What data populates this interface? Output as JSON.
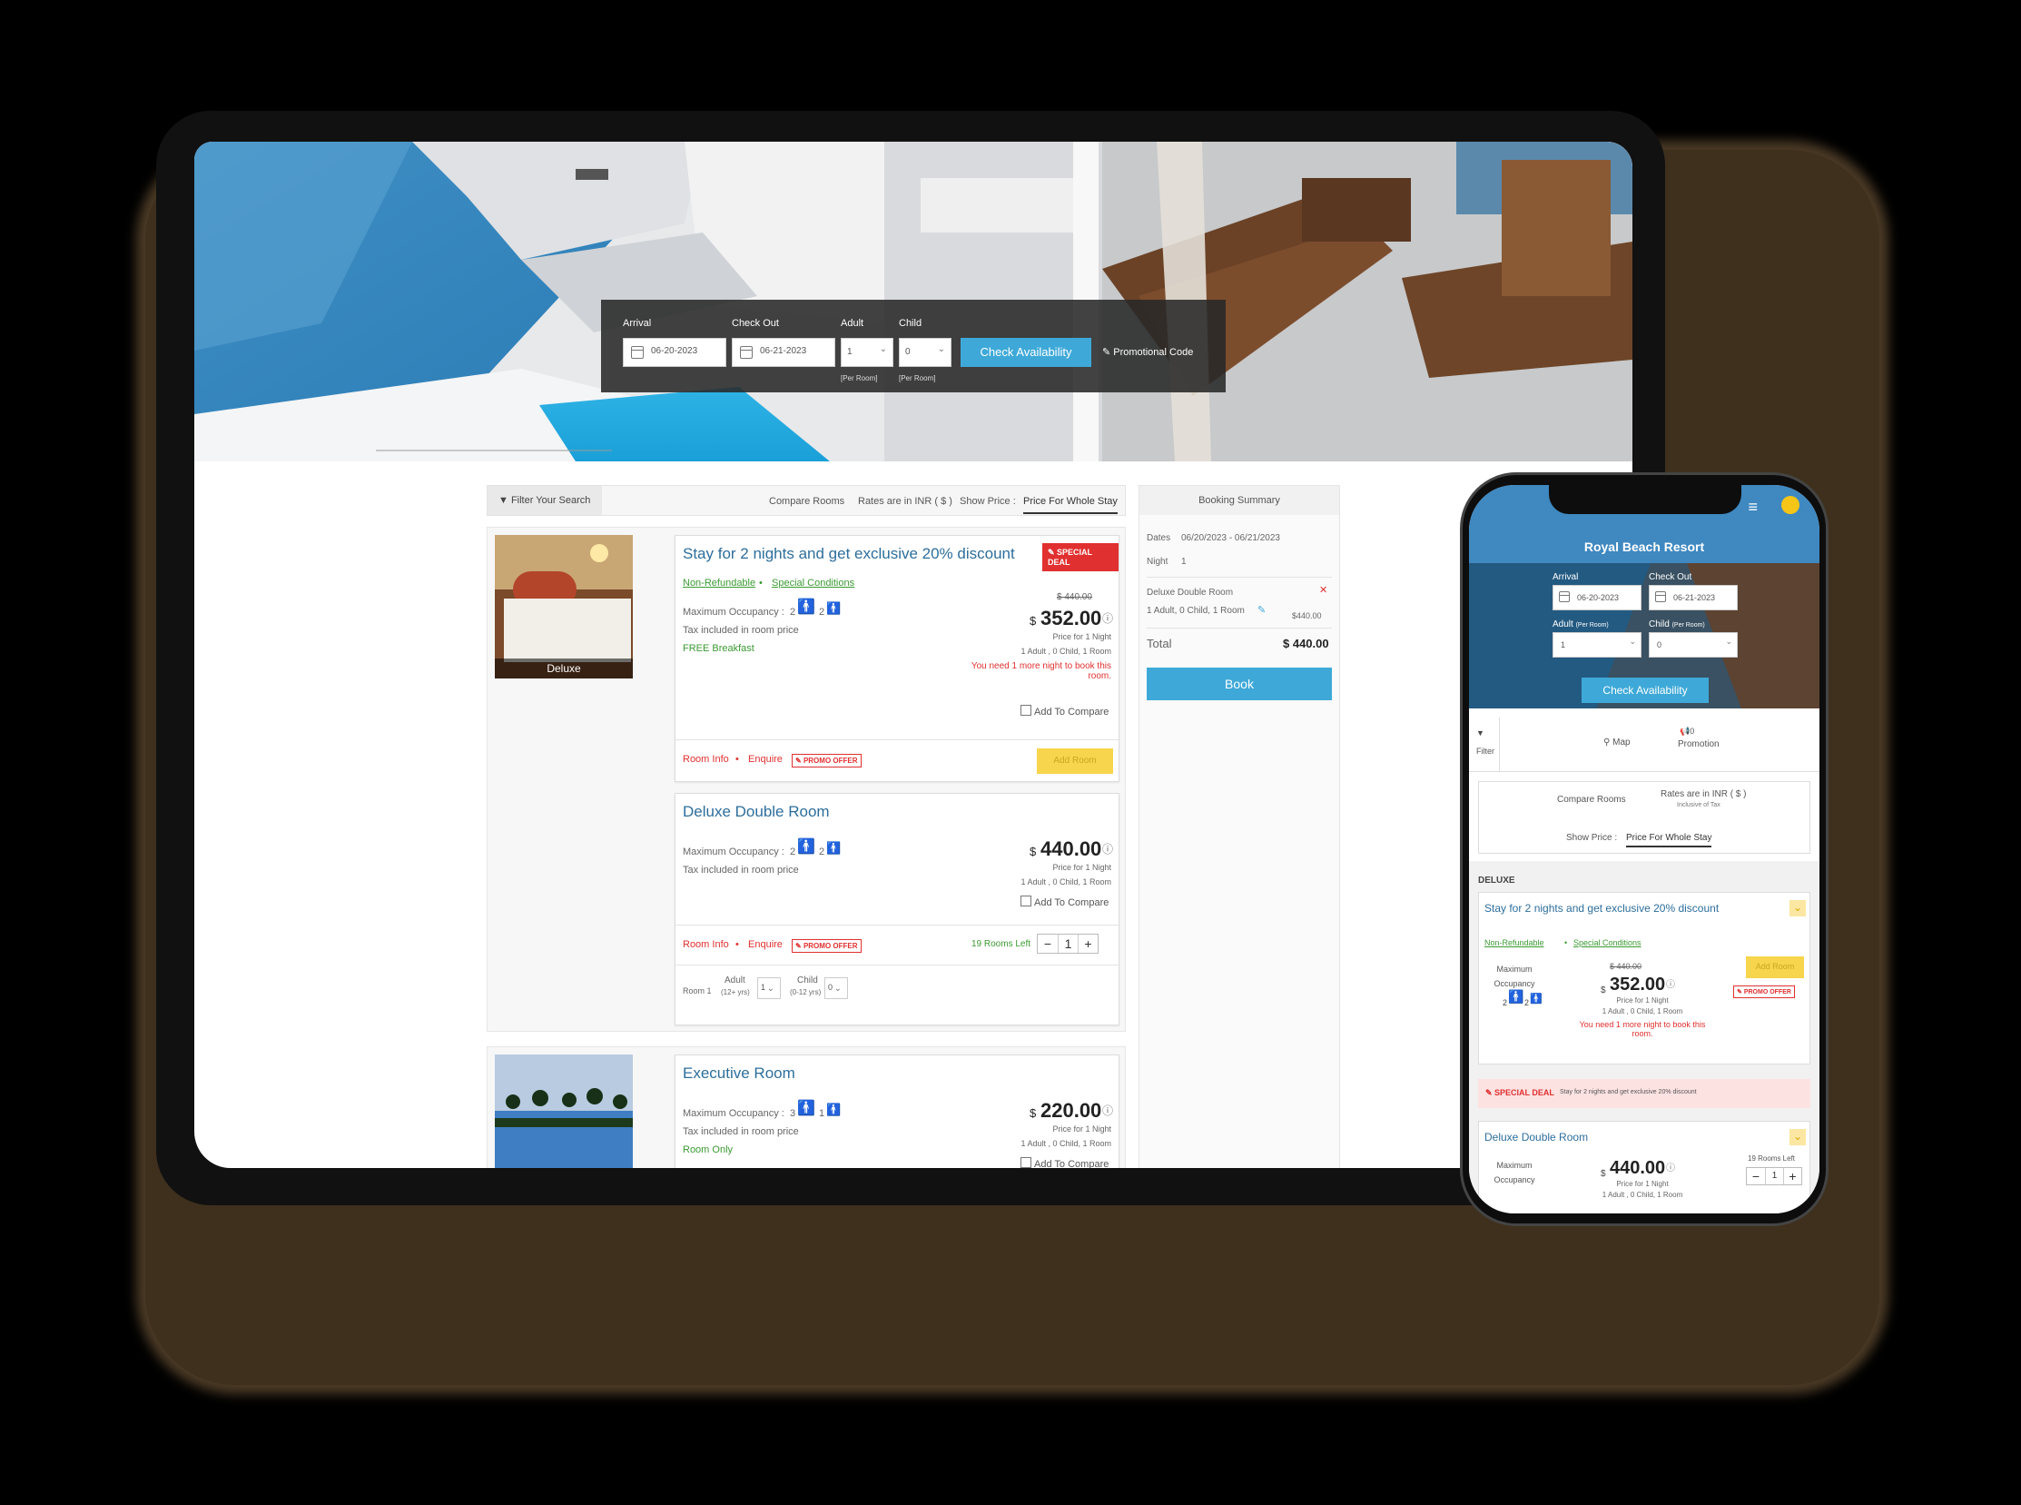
{
  "search": {
    "arrival_label": "Arrival",
    "checkout_label": "Check Out",
    "adult_label": "Adult",
    "child_label": "Child",
    "arrival_value": "06-20-2023",
    "checkout_value": "06-21-2023",
    "adult_value": "1",
    "child_value": "0",
    "per_room": "[Per Room]",
    "check_button": "Check Availability",
    "promo_code": "Promotional Code"
  },
  "toolbar": {
    "filter": "Filter Your Search",
    "compare": "Compare Rooms",
    "rates": "Rates are in INR ( $ )",
    "show_price": "Show Price :",
    "whole_stay": "Price For Whole Stay"
  },
  "deluxe": {
    "thumb_label": "Deluxe",
    "offer_title": "Stay for 2 nights and get exclusive 20% discount",
    "special_deal": "SPECIAL DEAL",
    "non_refundable": "Non-Refundable",
    "special_conditions": "Special Conditions",
    "max_occ": "Maximum Occupancy :",
    "adults": "2",
    "children": "2",
    "tax": "Tax included in room price",
    "breakfast": "FREE Breakfast",
    "old_price": "$ 440.00",
    "currency": "$",
    "price": "352.00",
    "price_for": "Price for 1 Night",
    "occupancy_line": "1 Adult , 0 Child, 1 Room",
    "warning": "You need 1 more night to book this room.",
    "add_compare": "Add To Compare",
    "room_info": "Room Info",
    "enquire": "Enquire",
    "promo_offer": "PROMO OFFER",
    "add_room": "Add Room"
  },
  "deluxe_double": {
    "title": "Deluxe Double Room",
    "max_occ": "Maximum Occupancy :",
    "adults": "2",
    "children": "2",
    "tax": "Tax included in room price",
    "currency": "$",
    "price": "440.00",
    "price_for": "Price for 1 Night",
    "occupancy_line": "1 Adult , 0 Child, 1 Room",
    "add_compare": "Add To Compare",
    "room_info": "Room Info",
    "enquire": "Enquire",
    "promo_offer": "PROMO OFFER",
    "rooms_left": "19 Rooms Left",
    "qty": "1",
    "room_label": "Room 1",
    "adult_label": "Adult",
    "adult_sub": "(12+ yrs)",
    "adult_val": "1",
    "child_label": "Child",
    "child_sub": "(0-12 yrs)",
    "child_val": "0"
  },
  "executive": {
    "title": "Executive Room",
    "max_occ": "Maximum Occupancy :",
    "adults": "3",
    "children": "1",
    "tax": "Tax included in room price",
    "plan": "Room Only",
    "currency": "$",
    "price": "220.00",
    "price_for": "Price for 1 Night",
    "occupancy_line": "1 Adult , 0 Child, 1 Room",
    "add_compare": "Add To Compare"
  },
  "summary": {
    "header": "Booking Summary",
    "dates_label": "Dates",
    "dates_value": "06/20/2023 - 06/21/2023",
    "night_label": "Night",
    "night_value": "1",
    "room_name": "Deluxe Double Room",
    "room_occ": "1 Adult, 0 Child, 1 Room",
    "room_price": "$440.00",
    "total_label": "Total",
    "total_value": "$ 440.00",
    "book": "Book"
  },
  "phone": {
    "resort": "Royal Beach Resort",
    "arrival_label": "Arrival",
    "checkout_label": "Check Out",
    "arrival_value": "06-20-2023",
    "checkout_value": "06-21-2023",
    "adult_label": "Adult",
    "child_label": "Child",
    "per_room": "(Per Room)",
    "adult_value": "1",
    "child_value": "0",
    "check_button": "Check Availability",
    "filter": "Filter",
    "map": "Map",
    "promotion": "Promotion",
    "promo_count": "0",
    "compare": "Compare Rooms",
    "rates": "Rates are in INR ( $ )",
    "inclusive": "Inclusive of Tax",
    "show_price": "Show Price :",
    "whole_stay": "Price For Whole Stay",
    "section": "DELUXE",
    "offer_title": "Stay for 2 nights and get exclusive 20% discount",
    "non_refundable": "Non-Refundable",
    "special_conditions": "Special Conditions",
    "max_occ": "Maximum Occupancy",
    "adults": "2",
    "children": "2",
    "old_price": "$ 440.00",
    "currency": "$",
    "price": "352.00",
    "price_for": "Price for 1 Night",
    "occupancy_line": "1 Adult , 0 Child, 1 Room",
    "warning": "You need 1 more night to book this room.",
    "add_room": "Add Room",
    "promo_offer": "PROMO OFFER",
    "special_deal": "SPECIAL DEAL",
    "deal_text": "Stay for 2 nights and get exclusive 20% discount",
    "double_title": "Deluxe Double Room",
    "double_price": "440.00",
    "double_price_for": "Price for 1 Night",
    "double_occ": "1 Adult , 0 Child, 1 Room",
    "rooms_left": "19 Rooms Left",
    "qty": "1"
  }
}
